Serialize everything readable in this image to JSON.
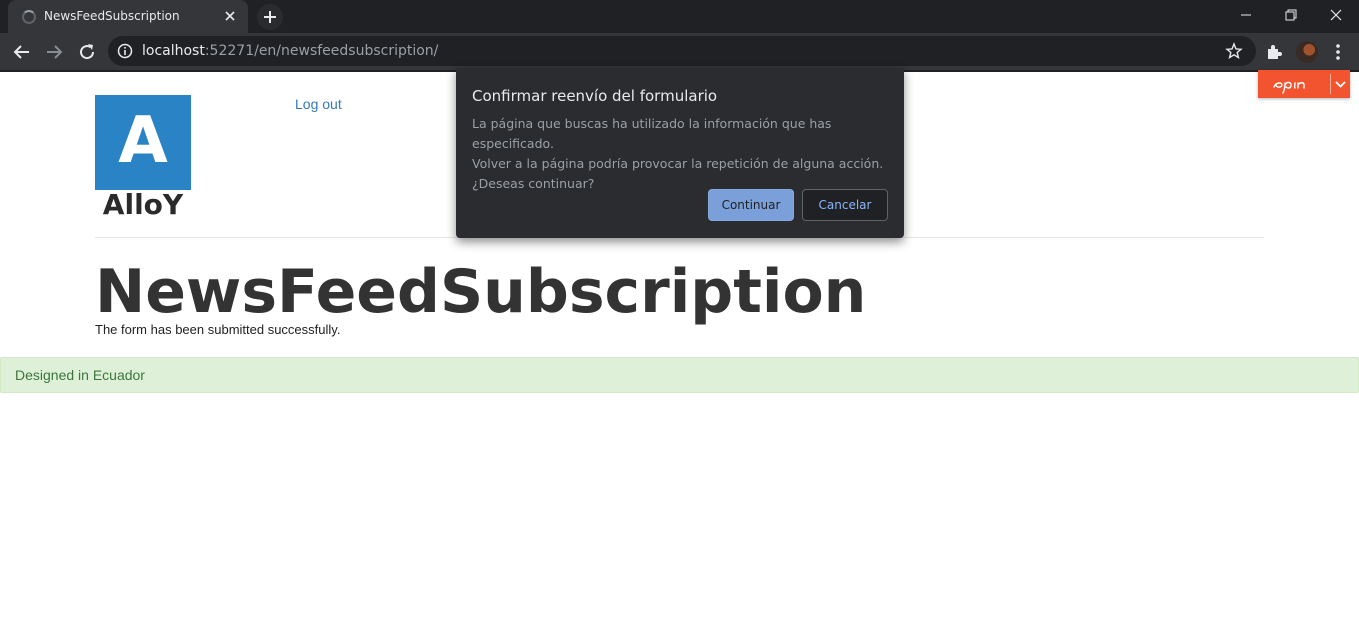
{
  "browser": {
    "tab_title": "NewsFeedSubscription",
    "url_host": "localhost",
    "url_rest": ":52271/en/newsfeedsubscription/",
    "icons": [
      "back-arrow-icon",
      "forward-arrow-icon",
      "reload-icon",
      "info-icon",
      "star-icon",
      "extensions-icon",
      "menu-icon",
      "close-icon",
      "plus-icon",
      "minimize-icon",
      "restore-icon"
    ]
  },
  "header": {
    "logo_letter": "A",
    "logo_word": "AlloY",
    "logout_label": "Log out"
  },
  "main": {
    "title": "NewsFeedSubscription",
    "message": "The form has been submitted successfully."
  },
  "footer": {
    "text": "Designed in Ecuador"
  },
  "epi": {
    "logo_text": "epi",
    "accent": "#f1542e"
  },
  "dialog": {
    "title": "Confirmar reenvío del formulario",
    "body_lines": [
      "La página que buscas ha utilizado la información que has especificado.",
      "Volver a la página podría provocar la repetición de alguna acción.",
      "¿Deseas continuar?"
    ],
    "continue_label": "Continuar",
    "cancel_label": "Cancelar"
  },
  "colors": {
    "logo_blue": "#2a83c5",
    "link": "#337ab7",
    "footer_bg": "#dff0d8",
    "footer_text": "#3c763d"
  }
}
